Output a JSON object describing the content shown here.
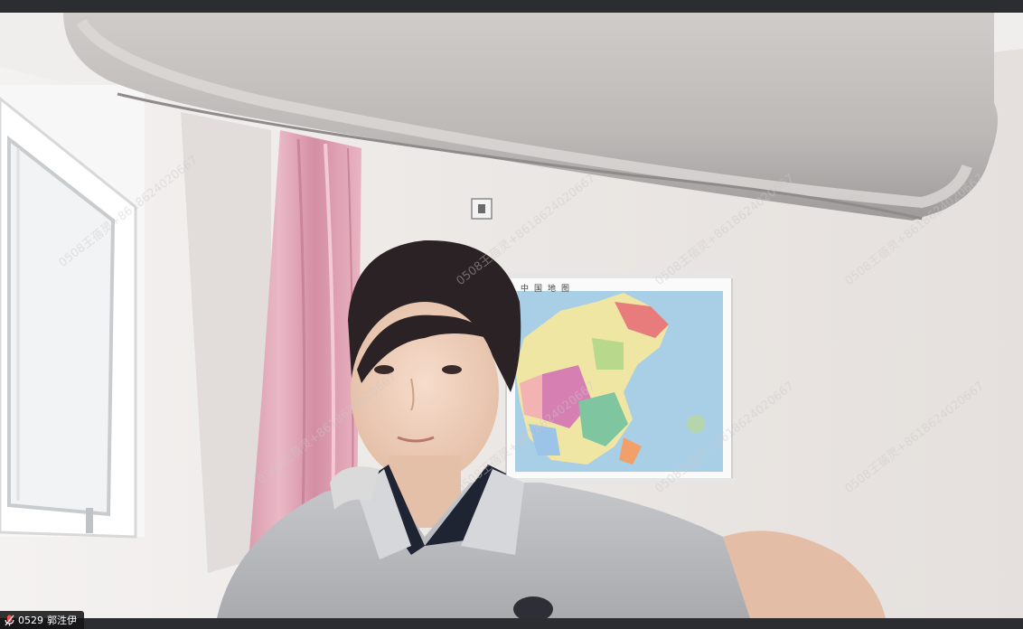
{
  "participant": {
    "id_label": "0529",
    "name": "郭泩伊",
    "mic_icon": "microphone-icon"
  },
  "watermarks": [
    "0508王蓓灵+8618624020667",
    "0508王蓓灵+8618624020667",
    "0508王蓓灵+8618624020667",
    "0508王蓓灵+8618624020667",
    "0508王蓓灵+8618624020667",
    "0508王蓓灵+8618624020667",
    "0508王蓓灵+8618624020667",
    "0508王蓓灵+8618624020667"
  ],
  "map_title": "中国地图",
  "colors": {
    "chrome": "#2b2d30",
    "wall": "#e9e5e2",
    "curtain": "#e7b0c0"
  }
}
